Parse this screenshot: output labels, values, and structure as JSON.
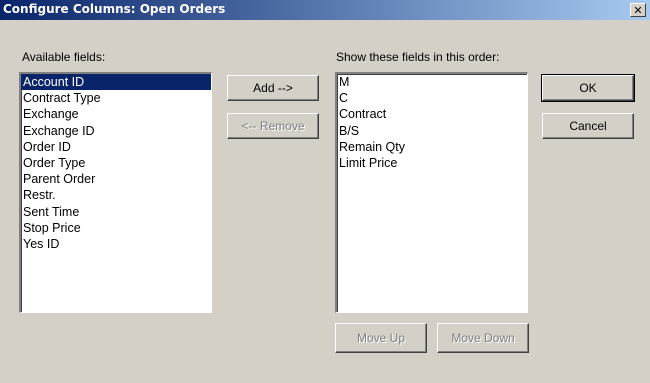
{
  "window": {
    "title": "Configure Columns: Open Orders",
    "close_glyph": "✕"
  },
  "available": {
    "label": "Available fields:",
    "items": [
      {
        "label": "Account ID"
      },
      {
        "label": "Contract Type"
      },
      {
        "label": "Exchange"
      },
      {
        "label": "Exchange ID"
      },
      {
        "label": "Order ID"
      },
      {
        "label": "Order Type"
      },
      {
        "label": "Parent Order"
      },
      {
        "label": "Restr."
      },
      {
        "label": "Sent Time"
      },
      {
        "label": "Stop Price"
      },
      {
        "label": "Yes ID"
      }
    ],
    "selected_index": 0
  },
  "shown": {
    "label": "Show these fields in this order:",
    "items": [
      {
        "label": "M"
      },
      {
        "label": "C"
      },
      {
        "label": "Contract"
      },
      {
        "label": "B/S"
      },
      {
        "label": "Remain Qty"
      },
      {
        "label": "Limit Price"
      }
    ]
  },
  "buttons": {
    "add": "Add -->",
    "remove": "<-- Remove",
    "ok": "OK",
    "cancel": "Cancel",
    "move_up": "Move Up",
    "move_down": "Move Down"
  },
  "colors": {
    "selection": "#0a246a",
    "dialog_face": "#d4d0c8",
    "title_gradient_start": "#0a246a",
    "title_gradient_end": "#a6caf0"
  }
}
